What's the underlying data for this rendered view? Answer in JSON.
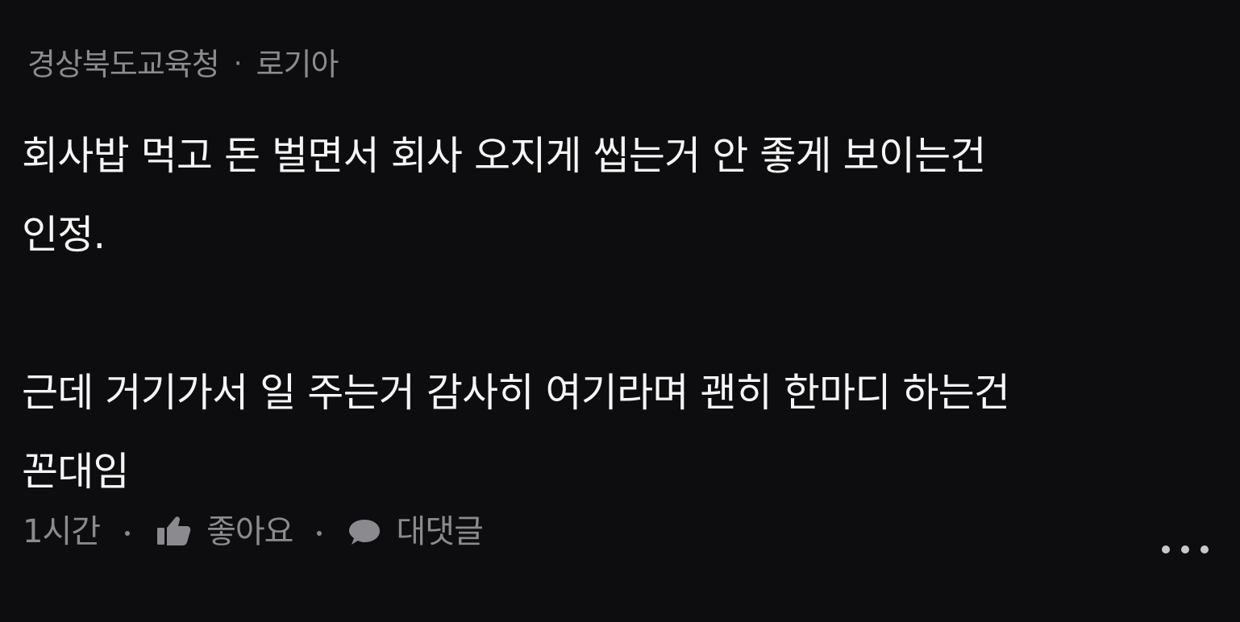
{
  "comment": {
    "author_org": "경상북도교육청",
    "separator": "·",
    "author_name": "로기아",
    "lines": [
      "회사밥 먹고 돈 벌면서 회사 오지게 씹는거 안 좋게 보이는건",
      "인정.",
      "",
      "근데 거기가서 일 주는거 감사히 여기라며 괜히 한마디 하는건",
      "꼰대임"
    ],
    "time": "1시간",
    "like_label": "좋아요",
    "reply_label": "대댓글"
  },
  "icons": {
    "like": "thumbs-up-icon",
    "reply": "speech-bubble-icon",
    "more": "more-horizontal-icon"
  },
  "colors": {
    "background": "#0d0d0f",
    "primary_text": "#f5f5f5",
    "secondary_text": "#8b8b8f"
  }
}
